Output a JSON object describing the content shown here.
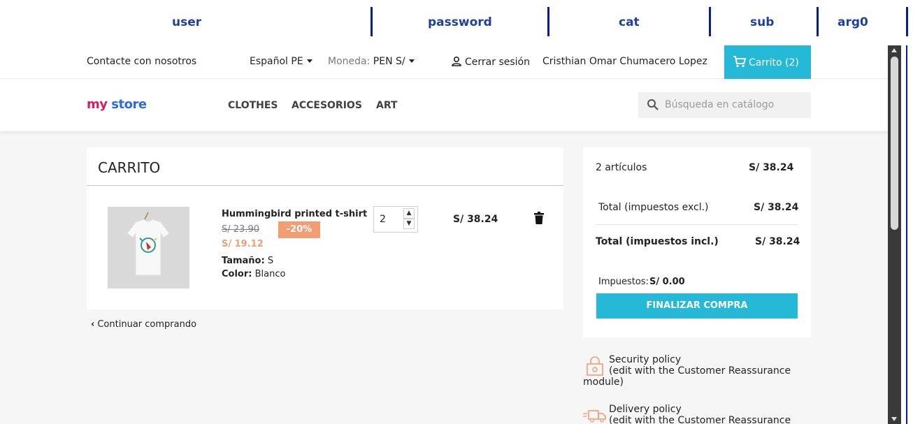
{
  "params": {
    "user": "user",
    "password": "password",
    "cat": "cat",
    "sub": "sub",
    "arg0": "arg0"
  },
  "topbar": {
    "contact": "Contacte con nosotros",
    "language": "Español PE",
    "currency_label": "Moneda:",
    "currency_value": "PEN S/",
    "logout": "Cerrar sesión",
    "user_name": "Cristhian Omar Chumacero Lopez",
    "cart": "Carrito (2)"
  },
  "navbar": {
    "logo_my": "my",
    "logo_store": "store",
    "menu": [
      "CLOTHES",
      "ACCESORIOS",
      "ART"
    ],
    "search_placeholder": "Búsqueda en catálogo"
  },
  "cart": {
    "title": "CARRITO",
    "product": {
      "name": "Hummingbird printed t-shirt",
      "old_price": "S/ 23.90",
      "discount": "-20%",
      "new_price": "S/ 19.12",
      "size_label": "Tamaño:",
      "size_value": "S",
      "color_label": "Color:",
      "color_value": "Blanco",
      "quantity": "2",
      "line_total": "S/ 38.24"
    },
    "continue": "Continuar comprando"
  },
  "summary": {
    "items_label": "2 artículos",
    "items_value": "S/ 38.24",
    "total_excl_label": "Total (impuestos excl.)",
    "total_excl_value": "S/ 38.24",
    "total_incl_label": "Total (impuestos incl.)",
    "total_incl_value": "S/ 38.24",
    "taxes_label": "Impuestos:",
    "taxes_value": "S/ 0.00",
    "checkout": "FINALIZAR COMPRA"
  },
  "reassurance": [
    {
      "title": "Security policy",
      "desc": "(edit with the Customer Reassurance",
      "desc2": "module)",
      "icon": "lock-icon"
    },
    {
      "title": "Delivery policy",
      "desc": "(edit with the Customer Reassurance",
      "desc2": "",
      "icon": "truck-icon"
    }
  ],
  "colors": {
    "accent": "#25b9d7",
    "discount": "#f39d72",
    "param_text": "#1f3fa3"
  }
}
